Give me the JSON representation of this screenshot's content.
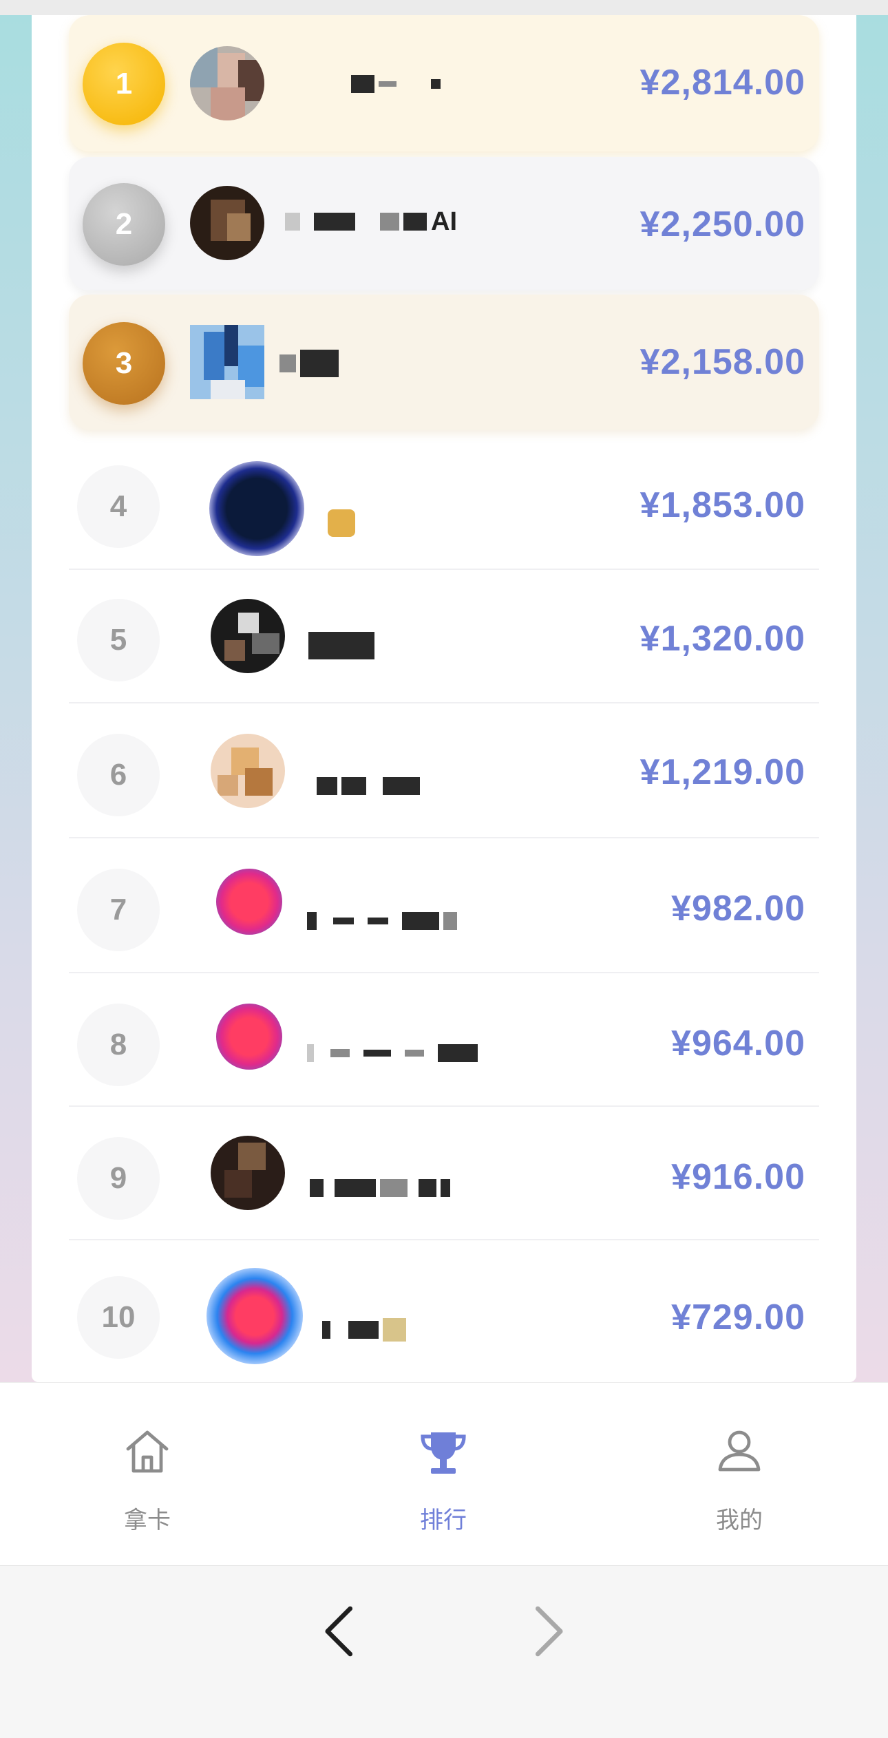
{
  "ranking": [
    {
      "rank": "1",
      "amount": "¥2,814.00",
      "tier": "gold"
    },
    {
      "rank": "2",
      "amount": "¥2,250.00",
      "tier": "silver",
      "name_suffix": "AI"
    },
    {
      "rank": "3",
      "amount": "¥2,158.00",
      "tier": "bronze"
    },
    {
      "rank": "4",
      "amount": "¥1,853.00",
      "tier": "plain"
    },
    {
      "rank": "5",
      "amount": "¥1,320.00",
      "tier": "plain"
    },
    {
      "rank": "6",
      "amount": "¥1,219.00",
      "tier": "plain"
    },
    {
      "rank": "7",
      "amount": "¥982.00",
      "tier": "plain"
    },
    {
      "rank": "8",
      "amount": "¥964.00",
      "tier": "plain"
    },
    {
      "rank": "9",
      "amount": "¥916.00",
      "tier": "plain"
    },
    {
      "rank": "10",
      "amount": "¥729.00",
      "tier": "plain"
    }
  ],
  "tabs": [
    {
      "label": "拿卡",
      "icon": "home-icon",
      "active": false
    },
    {
      "label": "排行",
      "icon": "trophy-icon",
      "active": true
    },
    {
      "label": "我的",
      "icon": "person-icon",
      "active": false
    }
  ],
  "browser": {
    "back_icon": "chevron-left-icon",
    "forward_icon": "chevron-right-icon"
  },
  "colors": {
    "accent": "#6f7fd8",
    "amount": "#7081d6",
    "gold": "#f5b300",
    "silver": "#a9a9a9",
    "bronze": "#b8721e"
  }
}
